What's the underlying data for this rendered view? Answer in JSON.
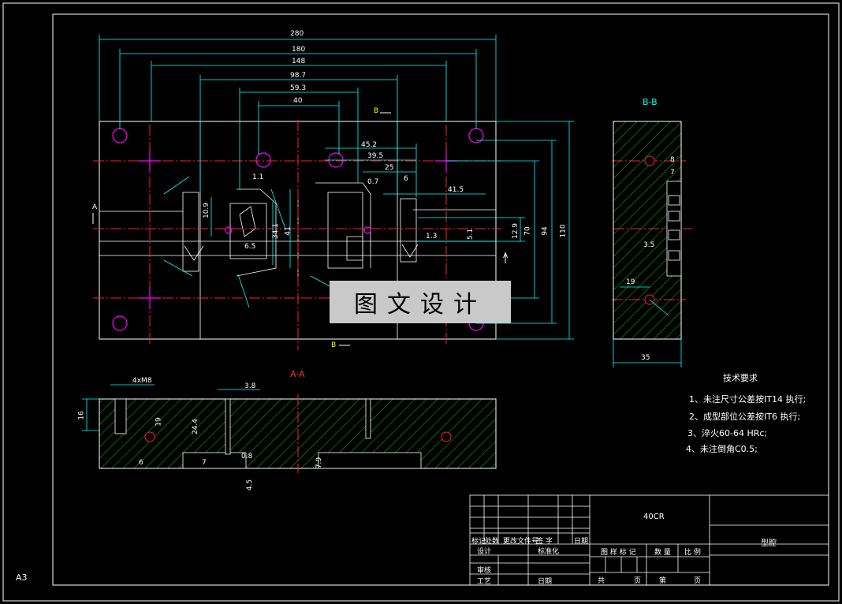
{
  "sheet_size": "A3",
  "views": {
    "section_aa": "A-A",
    "section_bb": "B-B",
    "cut_label_a": "A",
    "cut_label_b": "B"
  },
  "dimensions_top": [
    "280",
    "180",
    "148",
    "98.7",
    "59.3",
    "40"
  ],
  "dimensions_right": [
    "110",
    "94",
    "70",
    "12.9",
    "5.1",
    "1.3"
  ],
  "dimensions_inner": [
    "45.2",
    "39.5",
    "25",
    "6",
    "41.5",
    "34.1",
    "41",
    "10.9",
    "6.5",
    "1.1",
    "0.7"
  ],
  "dimensions_bb": [
    "35",
    "19",
    "8",
    "7",
    "3.5"
  ],
  "dimensions_aa": [
    "4xM8",
    "3.8",
    "16",
    "19",
    "24.4",
    "7",
    "6",
    "0.8",
    "4.5",
    "7.9"
  ],
  "watermark": "图文设计",
  "tech_requirements": {
    "title": "技术要求",
    "items": [
      "1、未注尺寸公差按IT14 执行;",
      "2、成型部位公差按IT6 执行;",
      "3、淬火60-64 HRc;",
      "4、未注倒角C0.5;"
    ]
  },
  "title_block": {
    "material": "40CR",
    "part_name": "型腔",
    "row_headers": [
      "标记",
      "处数",
      "更改文件号",
      "签 字",
      "日期"
    ],
    "design": "设计",
    "standardize": "标准化",
    "review": "审核",
    "process": "工艺",
    "date": "日期",
    "drawing_mark": "图 样 标 记",
    "quantity": "数 量",
    "scale": "比 例",
    "total": "共",
    "sheet": "页",
    "no": "第",
    "page": "页"
  }
}
